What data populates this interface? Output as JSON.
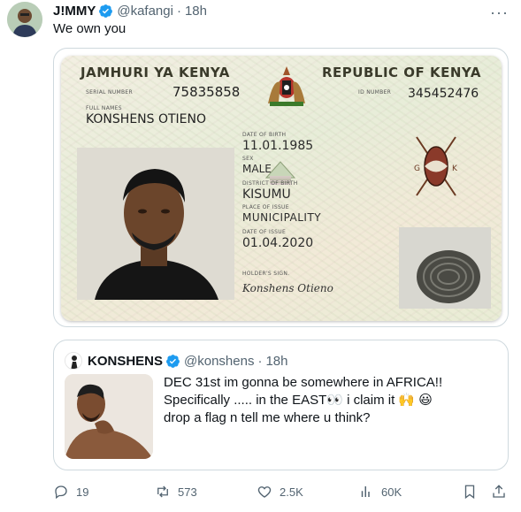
{
  "author": {
    "display_name": "J!MMY",
    "handle": "@kafangi",
    "separator": "·",
    "time": "18h",
    "text": "We own you"
  },
  "id_card": {
    "header_left": "JAMHURI YA KENYA",
    "header_right": "REPUBLIC OF KENYA",
    "serial_label": "SERIAL NUMBER",
    "serial_number": "75835858",
    "id_label": "ID NUMBER",
    "id_number": "345452476",
    "fullnames_label": "FULL NAMES",
    "full_name": "KONSHENS OTIENO",
    "dob_label": "DATE OF BIRTH",
    "dob": "11.01.1985",
    "sex_label": "SEX",
    "sex": "MALE",
    "district_label": "DISTRICT OF BIRTH",
    "district": "KISUMU",
    "place_label": "PLACE OF ISSUE",
    "place": "MUNICIPALITY",
    "issue_label": "DATE OF ISSUE",
    "issue_date": "01.04.2020",
    "sign_label": "HOLDER'S SIGN.",
    "signature": "Konshens Otieno",
    "shield_letters": [
      "G",
      "K"
    ]
  },
  "quote": {
    "display_name": "KONSHENS",
    "handle": "@konshens",
    "separator": "·",
    "time": "18h",
    "lines": [
      "DEC 31st im gonna be somewhere in AFRICA!!",
      "Specifically ..... in the EAST👀 i claim it 🙌 😃",
      "drop a flag n tell me where u think?"
    ]
  },
  "actions": {
    "replies": "19",
    "retweets": "573",
    "likes": "2.5K",
    "views": "60K"
  },
  "colors": {
    "verified": "#1d9bf0",
    "muted": "#536471",
    "border": "#cfd9de"
  }
}
